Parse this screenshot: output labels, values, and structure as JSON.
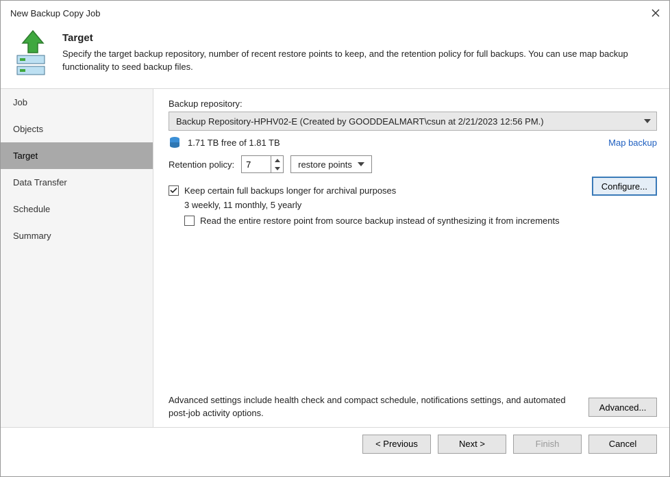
{
  "window": {
    "title": "New Backup Copy Job"
  },
  "header": {
    "title": "Target",
    "description": "Specify the target backup repository, number of recent restore points to keep, and the retention policy for full backups. You can use map backup functionality to seed backup files."
  },
  "sidebar": {
    "items": [
      {
        "label": "Job"
      },
      {
        "label": "Objects"
      },
      {
        "label": "Target",
        "active": true
      },
      {
        "label": "Data Transfer"
      },
      {
        "label": "Schedule"
      },
      {
        "label": "Summary"
      }
    ]
  },
  "content": {
    "repo_label": "Backup repository:",
    "repo_value": "Backup Repository-HPHV02-E (Created by GOODDEALMART\\csun at 2/21/2023 12:56 PM.)",
    "free_text": "1.71 TB free of 1.81 TB",
    "map_link": "Map backup",
    "retention_label": "Retention policy:",
    "retention_value": "7",
    "retention_unit": "restore points",
    "keep_full_checked": true,
    "keep_full_label": "Keep certain full backups longer for archival purposes",
    "keep_full_summary": "3 weekly, 11 monthly, 5 yearly",
    "read_entire_checked": false,
    "read_entire_label": "Read the entire restore point from source backup instead of synthesizing it from increments",
    "configure_label": "Configure...",
    "advanced_text": "Advanced settings include health check and compact schedule, notifications settings, and automated post-job activity options.",
    "advanced_btn": "Advanced..."
  },
  "footer": {
    "previous": "< Previous",
    "next": "Next >",
    "finish": "Finish",
    "cancel": "Cancel"
  }
}
